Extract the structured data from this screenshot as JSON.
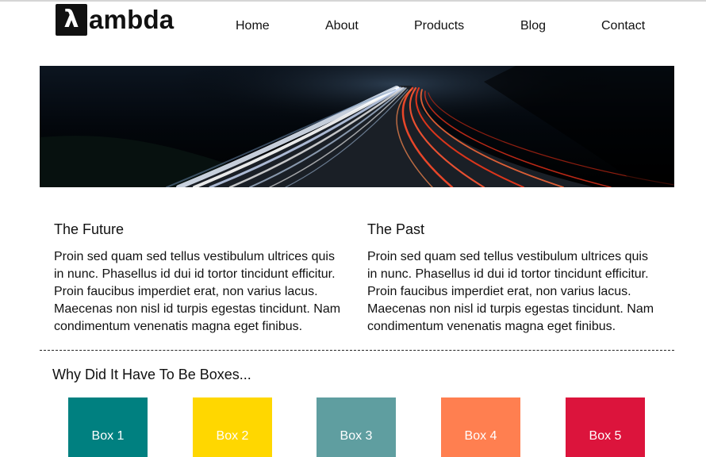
{
  "header": {
    "logo_mark": "λ",
    "logo_text": "ambda",
    "nav": [
      {
        "label": "Home"
      },
      {
        "label": "About"
      },
      {
        "label": "Products"
      },
      {
        "label": "Blog"
      },
      {
        "label": "Contact"
      }
    ]
  },
  "content": {
    "columns": [
      {
        "title": "The Future",
        "body": "Proin sed quam sed tellus vestibulum ultrices quis in nunc. Phasellus id dui id tortor tincidunt efficitur. Proin faucibus imperdiet erat, non varius lacus. Maecenas non nisl id turpis egestas tincidunt. Nam condimentum venenatis magna eget finibus."
      },
      {
        "title": "The Past",
        "body": "Proin sed quam sed tellus vestibulum ultrices quis in nunc. Phasellus id dui id tortor tincidunt efficitur. Proin faucibus imperdiet erat, non varius lacus. Maecenas non nisl id turpis egestas tincidunt. Nam condimentum venenatis magna eget finibus."
      }
    ]
  },
  "boxes": {
    "title": "Why Did It Have To Be Boxes...",
    "items": [
      {
        "label": "Box 1",
        "color": "#008080"
      },
      {
        "label": "Box 2",
        "color": "#FFD700"
      },
      {
        "label": "Box 3",
        "color": "#5F9EA0"
      },
      {
        "label": "Box 4",
        "color": "#FF7F50"
      },
      {
        "label": "Box 5",
        "color": "#DC143C"
      }
    ]
  }
}
